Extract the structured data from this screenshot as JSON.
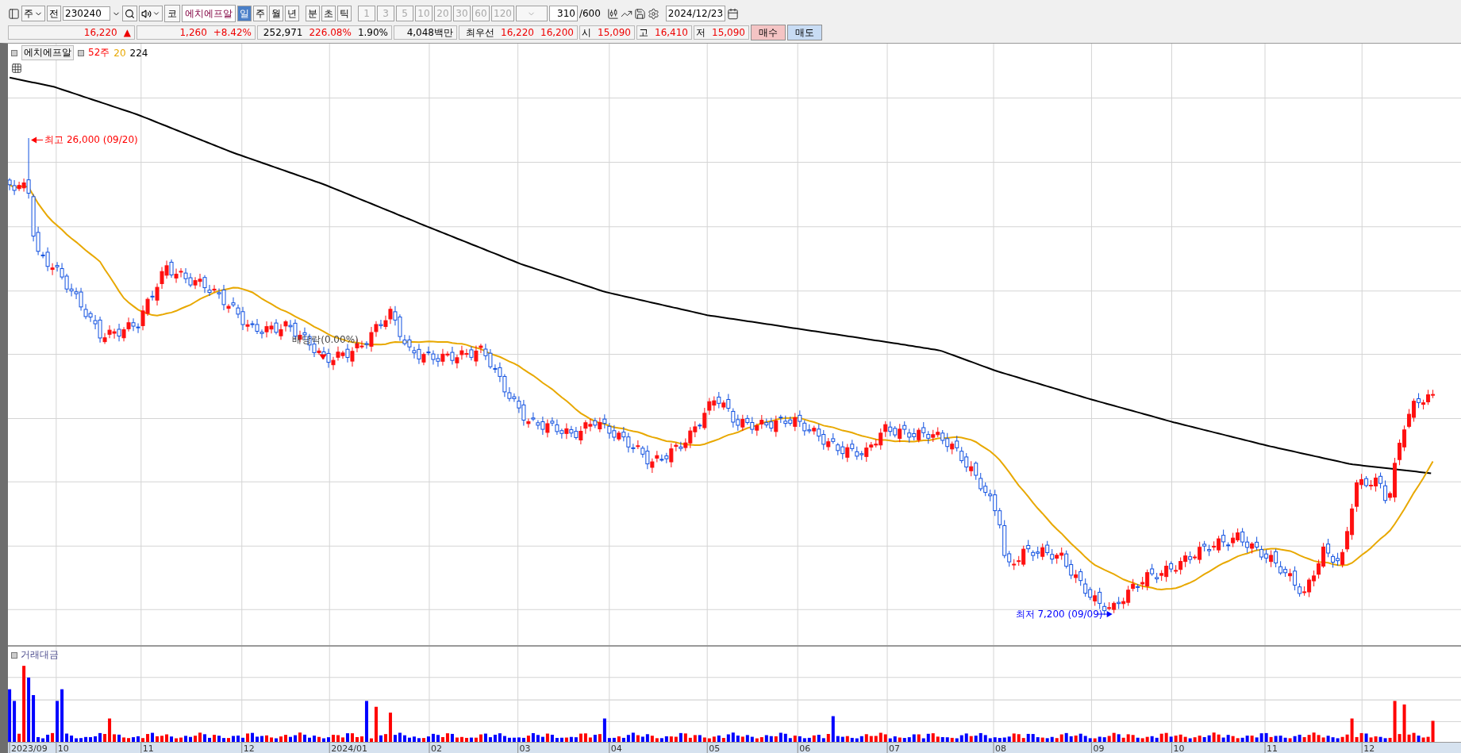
{
  "toolbar": {
    "period_type": "주",
    "mode_button": "전",
    "code": "230240",
    "market_badge": "코",
    "stock_name": "에치에프알",
    "periods": [
      {
        "label": "일",
        "selected": true
      },
      {
        "label": "주",
        "selected": false
      },
      {
        "label": "월",
        "selected": false
      },
      {
        "label": "년",
        "selected": false
      }
    ],
    "units": [
      {
        "label": "분"
      },
      {
        "label": "초"
      },
      {
        "label": "틱"
      }
    ],
    "minutes": [
      {
        "label": "1",
        "disabled": true
      },
      {
        "label": "3",
        "disabled": true
      },
      {
        "label": "5",
        "disabled": true
      },
      {
        "label": "10",
        "disabled": true
      },
      {
        "label": "20",
        "disabled": true
      },
      {
        "label": "30",
        "disabled": true
      },
      {
        "label": "60",
        "disabled": true
      },
      {
        "label": "120",
        "disabled": true
      }
    ],
    "count": "310",
    "max_count": "/600",
    "date": "2024/12/23"
  },
  "quote": {
    "price": "16,220",
    "change_mark": "▲",
    "change": "1,260",
    "change_rate": "+8.42%",
    "volume": "252,971",
    "volume_ratio": "226.08%",
    "turnover": "1.90%",
    "amount": "4,048백만",
    "best_label": "최우선",
    "ask": "16,220",
    "bid": "16,200",
    "fields": [
      {
        "label": "시",
        "value": "15,090"
      },
      {
        "label": "고",
        "value": "16,410"
      },
      {
        "label": "저",
        "value": "15,090"
      }
    ],
    "buttons": [
      {
        "label": "매수",
        "kind": "buy"
      },
      {
        "label": "매도",
        "kind": "sell"
      }
    ]
  },
  "chart": {
    "legend": {
      "name": "에치에프알",
      "items": [
        {
          "label": "52주",
          "color": "#ff0000"
        },
        {
          "label": "20",
          "color": "#e8a800"
        },
        {
          "label": "224",
          "color": "#000000"
        }
      ]
    },
    "high_marker": "최고 26,000 (09/20)",
    "low_marker": "최저 7,200 (09/09)",
    "event_marker": "배당락(0.00%)",
    "volume_title": "거래대금",
    "x_labels": [
      "2023/09",
      "10",
      "11",
      "12",
      "2024/01",
      "02",
      "03",
      "04",
      "05",
      "06",
      "07",
      "08",
      "09",
      "10",
      "11",
      "12"
    ]
  }
}
